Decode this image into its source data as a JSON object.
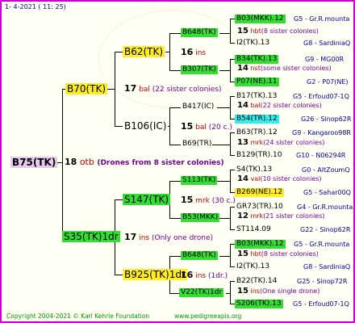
{
  "date_line": "1-  4-2021  ( 11: 25)",
  "copyright": "Copyright 2004-2021 © Karl Kehrle Foundation",
  "website": "www.pedigreeapis.org",
  "root": {
    "name": "B75(TK)",
    "num": "18",
    "code": "otb",
    "note": "(Drones from 8 sister colonies)"
  },
  "sire": {
    "name": "B70(TK)",
    "num": "17",
    "code": "bal",
    "note": "(22 sister colonies)"
  },
  "dam": {
    "name": "S35(TK)1dr",
    "num": "17",
    "code": "ins",
    "note": "(Only one drone)"
  },
  "ss": {
    "name": "B62(TK)",
    "num": "16",
    "code": "ins"
  },
  "sd": {
    "name": "B106(IC)",
    "num": "15",
    "code": "bal",
    "note": "(20 c.)"
  },
  "ds": {
    "name": "S147(TK)",
    "num": "15",
    "code": "mrk",
    "note": "(30 c.)"
  },
  "dd": {
    "name": "B925(TK)1dr",
    "num": "16",
    "code": "ins",
    "note": "(1dr.)"
  },
  "g": [
    {
      "name": "B648(TK)",
      "num": "15",
      "code": "hbt",
      "note": "(8 sister colonies)"
    },
    {
      "name": "B307(TK)",
      "num": "14",
      "code": "nst",
      "note": "(some sister colonies)"
    },
    {
      "name": "B417(IC)",
      "num": "14",
      "code": "bal",
      "note": "(22 sister colonies)"
    },
    {
      "name": "B69(TR)",
      "num": "13",
      "code": "mrk",
      "note": "(24 sister colonies)"
    },
    {
      "name": "S113(TK)",
      "num": "14",
      "code": "val",
      "note": "(10 sister colonies)"
    },
    {
      "name": "B53(MKK)",
      "num": "12",
      "code": "mrk",
      "note": "(21 sister colonies)"
    },
    {
      "name": "B648(TK)",
      "num": "15",
      "code": "hbt",
      "note": "(8 sister colonies)"
    },
    {
      "name": "V22(TK)1dr",
      "num": "15",
      "code": "ins",
      "note": "(One single drone)"
    }
  ],
  "gg": [
    {
      "name": "B03(MKK).12",
      "ref": "G5 - Gr.R.mounta"
    },
    {
      "name": "I2(TK).13",
      "ref": "G8 - SardiniaQ"
    },
    {
      "name": "B34(TK).13",
      "ref": "G9 - MG00R"
    },
    {
      "name": "P07(NE).11",
      "ref": "G2 - P07(NE)"
    },
    {
      "name": "B17(TK).13",
      "ref": "G5 - Erfoud07-1Q"
    },
    {
      "name": "B54(TR).12",
      "ref": "G26 - Sinop62R"
    },
    {
      "name": "B63(TR).12",
      "ref": "G9 - Kangaroo98R"
    },
    {
      "name": "B129(TR).10",
      "ref": "G10 - N06294R"
    },
    {
      "name": "S4(TK).13",
      "ref": "G0 - AltZoumQ"
    },
    {
      "name": "B269(NE).12",
      "ref": "G5 - Sahar00Q"
    },
    {
      "name": "GR73(TR).10",
      "ref": "G4 - Gr.R.mounta"
    },
    {
      "name": "ST114.09",
      "ref": "G22 - Sinop62R"
    },
    {
      "name": "B03(MKK).12",
      "ref": "G5 - Gr.R.mounta"
    },
    {
      "name": "I2(TK).13",
      "ref": "G8 - SardiniaQ"
    },
    {
      "name": "B22(TK).14",
      "ref": "G25 - Sinop72R"
    },
    {
      "name": "S206(TK).13",
      "ref": "G5 - Erfoud07-1Q"
    }
  ]
}
